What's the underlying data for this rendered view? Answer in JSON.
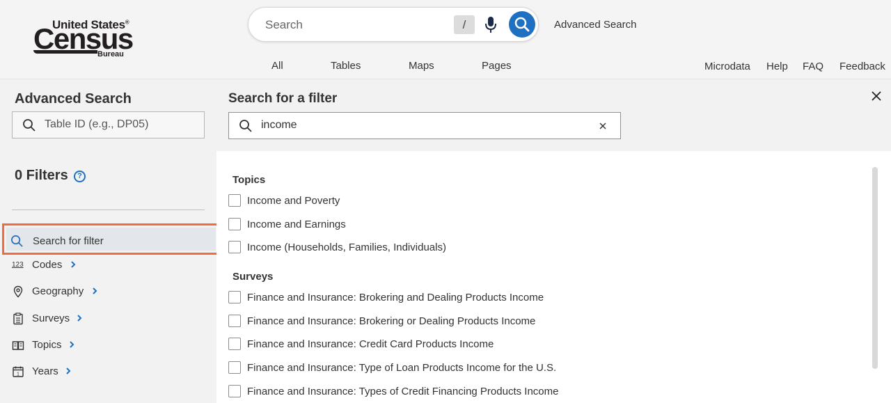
{
  "logo": {
    "line1": "United States",
    "reg": "®",
    "line2": "Census",
    "line3": "Bureau"
  },
  "search": {
    "placeholder": "Search",
    "shortcut": "/",
    "advanced_link": "Advanced Search"
  },
  "tabs": [
    {
      "label": "All"
    },
    {
      "label": "Tables"
    },
    {
      "label": "Maps"
    },
    {
      "label": "Pages"
    }
  ],
  "utility_links": [
    {
      "label": "Microdata"
    },
    {
      "label": "Help"
    },
    {
      "label": "FAQ"
    },
    {
      "label": "Feedback"
    }
  ],
  "left_panel": {
    "title": "Advanced Search",
    "table_id_placeholder": "Table ID (e.g., DP05)",
    "filters_count_label": "0 Filters",
    "help_glyph": "?",
    "search_for_filter": "Search for filter",
    "nav": [
      {
        "label": "Codes",
        "icon": "numbers-123-icon"
      },
      {
        "label": "Geography",
        "icon": "map-pin-icon"
      },
      {
        "label": "Surveys",
        "icon": "clipboard-icon"
      },
      {
        "label": "Topics",
        "icon": "book-icon"
      },
      {
        "label": "Years",
        "icon": "calendar-icon"
      }
    ],
    "codes_icon_text": "123",
    "years_icon_text": "1"
  },
  "filter_panel": {
    "title": "Search for a filter",
    "query": "income",
    "groups": [
      {
        "heading": "Topics",
        "options": [
          "Income and Poverty",
          "Income and Earnings",
          "Income (Households, Families, Individuals)"
        ]
      },
      {
        "heading": "Surveys",
        "options": [
          "Finance and Insurance: Brokering and Dealing Products Income",
          "Finance and Insurance: Brokering or Dealing Products Income",
          "Finance and Insurance: Credit Card Products Income",
          "Finance and Insurance: Type of Loan Products Income for the U.S.",
          "Finance and Insurance: Types of Credit Financing Products Income"
        ]
      }
    ]
  },
  "colors": {
    "accent": "#1f70c1",
    "highlight_border": "#f26c3b"
  }
}
